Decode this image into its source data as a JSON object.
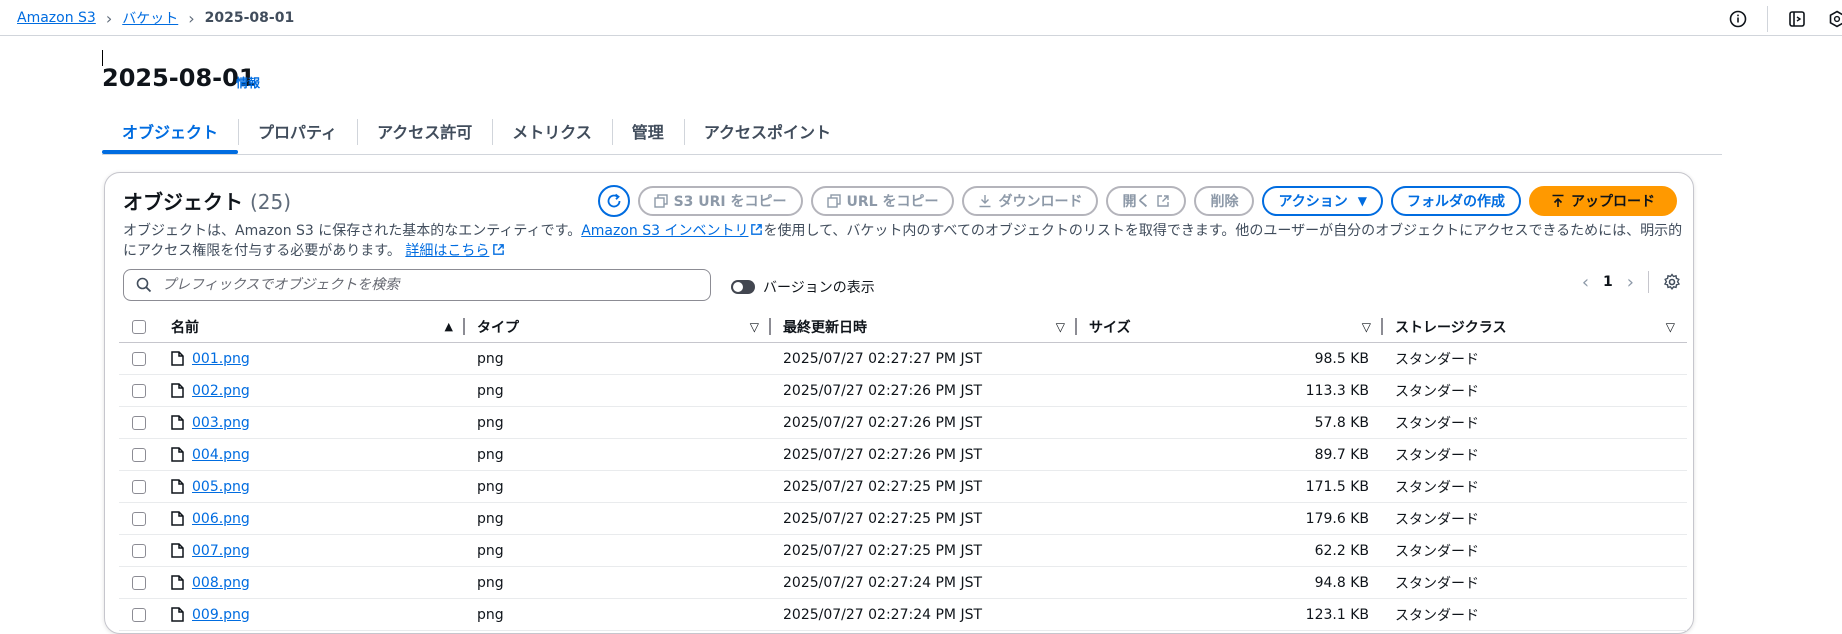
{
  "breadcrumb": {
    "root": "Amazon S3",
    "bucket": "バケット",
    "current": "2025-08-01"
  },
  "header": {
    "title": "2025-08-01",
    "info": "情報"
  },
  "tabs": [
    {
      "label": "オブジェクト",
      "active": true
    },
    {
      "label": "プロパティ"
    },
    {
      "label": "アクセス許可"
    },
    {
      "label": "メトリクス"
    },
    {
      "label": "管理"
    },
    {
      "label": "アクセスポイント"
    }
  ],
  "objects": {
    "title": "オブジェクト",
    "count": "(25)",
    "buttons": {
      "copy_s3_uri": "S3 URI をコピー",
      "copy_url": "URL をコピー",
      "download": "ダウンロード",
      "open": "開く",
      "delete": "削除",
      "actions": "アクション",
      "create_folder": "フォルダの作成",
      "upload": "アップロード"
    },
    "desc_part1": "オブジェクトは、Amazon S3 に保存された基本的なエンティティです。",
    "desc_link": "Amazon S3 インベントリ",
    "desc_part2": "を使用して、バケット内のすべてのオブジェクトのリストを取得できます。他のユーザーが自分のオブジェクトにアクセスできるためには、明示的にアクセス権限を付与する必要があります。",
    "desc_more": "詳細はこちら",
    "search_placeholder": "プレフィックスでオブジェクトを検索",
    "version_label": "バージョンの表示",
    "page_number": "1"
  },
  "table": {
    "headers": {
      "name": "名前",
      "type": "タイプ",
      "modified": "最終更新日時",
      "size": "サイズ",
      "storage": "ストレージクラス"
    },
    "rows": [
      {
        "name": "001.png",
        "type": "png",
        "modified": "2025/07/27 02:27:27 PM JST",
        "size": "98.5 KB",
        "storage": "スタンダード"
      },
      {
        "name": "002.png",
        "type": "png",
        "modified": "2025/07/27 02:27:26 PM JST",
        "size": "113.3 KB",
        "storage": "スタンダード"
      },
      {
        "name": "003.png",
        "type": "png",
        "modified": "2025/07/27 02:27:26 PM JST",
        "size": "57.8 KB",
        "storage": "スタンダード"
      },
      {
        "name": "004.png",
        "type": "png",
        "modified": "2025/07/27 02:27:26 PM JST",
        "size": "89.7 KB",
        "storage": "スタンダード"
      },
      {
        "name": "005.png",
        "type": "png",
        "modified": "2025/07/27 02:27:25 PM JST",
        "size": "171.5 KB",
        "storage": "スタンダード"
      },
      {
        "name": "006.png",
        "type": "png",
        "modified": "2025/07/27 02:27:25 PM JST",
        "size": "179.6 KB",
        "storage": "スタンダード"
      },
      {
        "name": "007.png",
        "type": "png",
        "modified": "2025/07/27 02:27:25 PM JST",
        "size": "62.2 KB",
        "storage": "スタンダード"
      },
      {
        "name": "008.png",
        "type": "png",
        "modified": "2025/07/27 02:27:24 PM JST",
        "size": "94.8 KB",
        "storage": "スタンダード"
      },
      {
        "name": "009.png",
        "type": "png",
        "modified": "2025/07/27 02:27:24 PM JST",
        "size": "123.1 KB",
        "storage": "スタンダード"
      }
    ]
  },
  "colors": {
    "link": "#006ce0",
    "primary_orange": "#ff9900",
    "border": "#c6c6cd"
  }
}
